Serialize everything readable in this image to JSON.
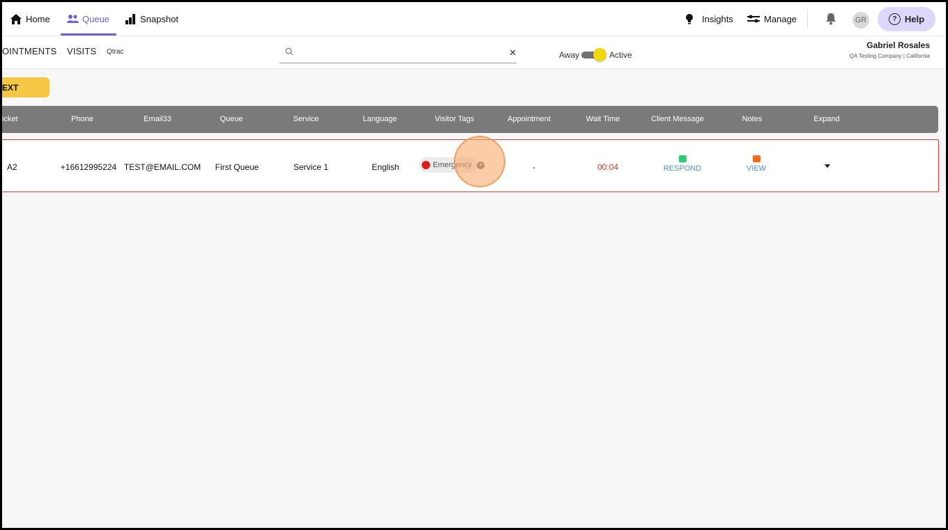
{
  "nav": {
    "home_label": "Home",
    "queue_label": "Queue",
    "snapshot_label": "Snapshot",
    "insights_label": "Insights",
    "manage_label": "Manage",
    "avatar_initials": "GR",
    "help_label": "Help",
    "active_tab": "Queue"
  },
  "subnav": {
    "tab_appointments": "OINTMENTS",
    "tab_visits": "VISITS",
    "system_label": "Qtrac",
    "search": {
      "value": "",
      "placeholder": ""
    },
    "status_away": "Away",
    "status_active": "Active",
    "status_value": "Active"
  },
  "user": {
    "name": "Gabriel Rosales",
    "org": "QA Testing Company | California"
  },
  "next_button": "EXT",
  "table": {
    "columns": [
      "icket",
      "Phone",
      "Email33",
      "Queue",
      "Service",
      "Language",
      "Visitor Tags",
      "Appointment",
      "Wait Time",
      "Client Message",
      "Notes",
      "Expand"
    ],
    "rows": [
      {
        "ticket": "A2",
        "phone": "+16612995224",
        "email": "TEST@EMAIL.COM",
        "queue": "First Queue",
        "service": "Service 1",
        "language": "English",
        "visitor_tag": "Emergency",
        "appointment": "-",
        "wait_time": "00:04",
        "client_message": "RESPOND",
        "notes": "VIEW"
      }
    ]
  },
  "colors": {
    "accent": "#6b5fd6",
    "next_button": "#f6c744",
    "header_bg": "#7a7a7a",
    "row_border": "#e53935",
    "wait_time": "#c0392b",
    "tag_dot": "#e01b1b",
    "respond_icon": "#2ecc71",
    "view_icon": "#f26a1b"
  },
  "icons": [
    "home-icon",
    "people-icon",
    "bar-chart-icon",
    "lightbulb-icon",
    "sliders-icon",
    "bell-icon",
    "question-icon",
    "search-icon",
    "close-icon",
    "chat-icon",
    "edit-note-icon",
    "caret-down-icon",
    "plus-circle-icon"
  ]
}
